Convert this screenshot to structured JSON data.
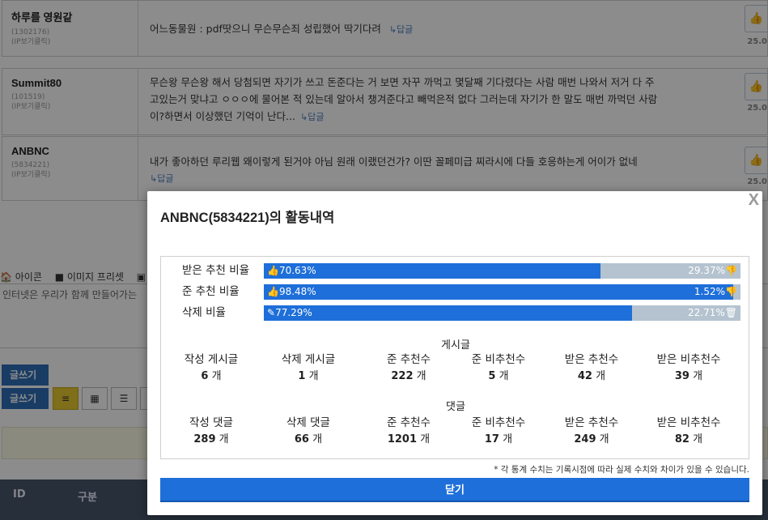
{
  "comments": [
    {
      "nick": "하루를 영원같",
      "uid": "(1302176)",
      "ip": "(IP보기클릭)",
      "text": "어느동물원 : pdf땃으니 무슨무슨죄 성립했어 딱기다려",
      "reply": "↳답글",
      "date": "25.0"
    },
    {
      "nick": "Summit80",
      "uid": "(101519)",
      "ip": "(IP보기클릭)",
      "text1": "무슨왕 무슨왕 해서 당첨되면 자기가 쓰고 돈준다는 거 보면 자꾸 까먹고 몇달째 기다렸다는 사람 매번 나와서 저거 다 주",
      "text2": "고있는거 맞냐고 ㅇㅇㅇ에 물어본 적 있는데 알아서 챙겨준다고 빼먹은적 없다 그러는데 자기가 한 말도 매번 까먹던 사람",
      "text3": "이?하면서 이상했던 기억이 난다...",
      "reply": "↳답글",
      "date": "25.0"
    },
    {
      "nick": "ANBNC",
      "uid": "(5834221)",
      "ip": "(IP보기클릭)",
      "text": "내가 좋아하던 루리웹 왜이렇게 된거야 아님 원래 이랬던건가? 이딴 꼴페미급 찌라시에 다들 호응하는게 어이가 없네",
      "reply": "↳답글",
      "date": "25.0"
    }
  ],
  "toolbar": {
    "icon": "아이콘",
    "image_preset": "이미지 프리셋"
  },
  "editor": {
    "placeholder": "인터넷은 우리가 함께 만들어가는"
  },
  "write_button": "글쓰기",
  "table_head": {
    "id": "ID",
    "category": "구분"
  },
  "modal": {
    "title": "ANBNC(5834221)의 활동내역",
    "close_x": "X",
    "rates": [
      {
        "label": "받은 추천 비율",
        "left": "70.63%",
        "right": "29.37%",
        "left_icon": "thumbs-up-icon",
        "right_icon": "thumbs-down-icon",
        "fill_fraction": 0.7063
      },
      {
        "label": "준 추천 비율",
        "left": "98.48%",
        "right": "1.52%",
        "left_icon": "thumbs-up-icon",
        "right_icon": "thumbs-down-icon",
        "fill_fraction": 0.9848
      },
      {
        "label": "삭제 비율",
        "left": "77.29%",
        "right": "22.71%",
        "left_icon": "edit-icon",
        "right_icon": "trash-icon",
        "fill_fraction": 0.7729
      }
    ],
    "posts_title": "게시글",
    "posts": [
      {
        "label": "작성 게시글",
        "value": "6",
        "unit": "개"
      },
      {
        "label": "삭제 게시글",
        "value": "1",
        "unit": "개"
      },
      {
        "label": "준 추천수",
        "value": "222",
        "unit": "개"
      },
      {
        "label": "준 비추천수",
        "value": "5",
        "unit": "개"
      },
      {
        "label": "받은 추천수",
        "value": "42",
        "unit": "개"
      },
      {
        "label": "받은 비추천수",
        "value": "39",
        "unit": "개"
      }
    ],
    "comments_title": "댓글",
    "comment_stats": [
      {
        "label": "작성 댓글",
        "value": "289",
        "unit": "개"
      },
      {
        "label": "삭제 댓글",
        "value": "66",
        "unit": "개"
      },
      {
        "label": "준 추천수",
        "value": "1201",
        "unit": "개"
      },
      {
        "label": "준 비추천수",
        "value": "17",
        "unit": "개"
      },
      {
        "label": "받은 추천수",
        "value": "249",
        "unit": "개"
      },
      {
        "label": "받은 비추천수",
        "value": "82",
        "unit": "개"
      }
    ],
    "footnote": "* 각 통계 수치는 기록시점에 따라 실제 수치와 차이가 있을 수 있습니다.",
    "close_button": "닫기"
  },
  "colors": {
    "accent": "#1e6fd9",
    "bar_bg": "#b4c3cf"
  }
}
